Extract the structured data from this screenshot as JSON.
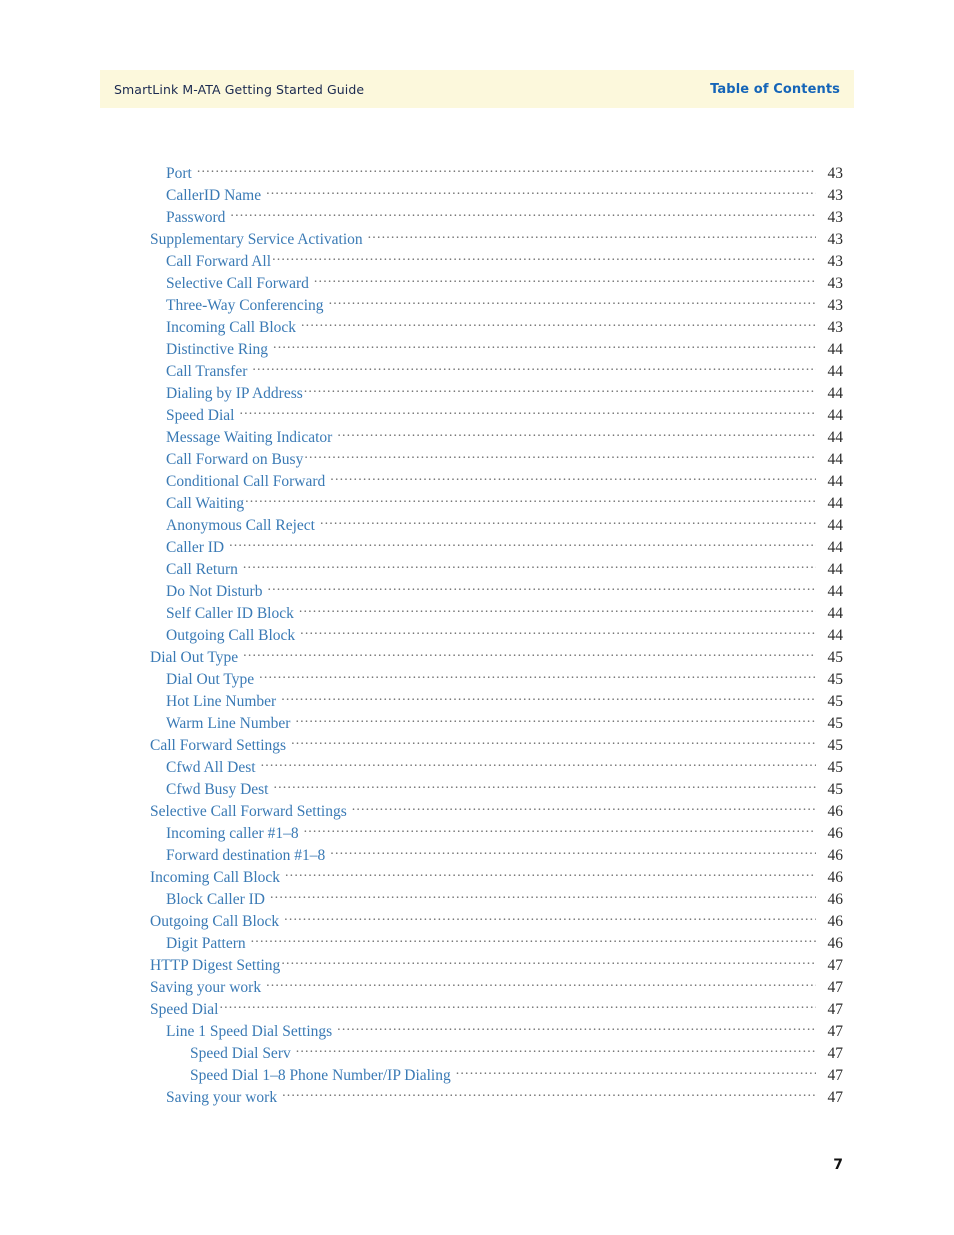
{
  "header": {
    "document_title": "SmartLink M-ATA Getting Started Guide",
    "section_title": "Table of Contents",
    "background_color": "#fcf8dc",
    "title_color": "#1b2a50",
    "section_color": "#1565b8"
  },
  "folio": {
    "page_number": "7"
  },
  "toc": {
    "text_color": "#3a7ab5",
    "page_number_color": "#2b2b2b",
    "entries": [
      {
        "label": "Port",
        "page": "43",
        "level": 1,
        "tight": false
      },
      {
        "label": "CallerID Name",
        "page": "43",
        "level": 1,
        "tight": false
      },
      {
        "label": "Password",
        "page": "43",
        "level": 1,
        "tight": false
      },
      {
        "label": "Supplementary Service Activation",
        "page": "43",
        "level": 0,
        "tight": false
      },
      {
        "label": "Call Forward All",
        "page": "43",
        "level": 1,
        "tight": true
      },
      {
        "label": "Selective Call Forward",
        "page": "43",
        "level": 1,
        "tight": false
      },
      {
        "label": "Three-Way Conferencing",
        "page": "43",
        "level": 1,
        "tight": false
      },
      {
        "label": "Incoming Call Block",
        "page": "43",
        "level": 1,
        "tight": false
      },
      {
        "label": "Distinctive Ring",
        "page": "44",
        "level": 1,
        "tight": false
      },
      {
        "label": "Call Transfer",
        "page": "44",
        "level": 1,
        "tight": false
      },
      {
        "label": "Dialing by IP Address",
        "page": "44",
        "level": 1,
        "tight": true
      },
      {
        "label": "Speed Dial",
        "page": "44",
        "level": 1,
        "tight": false
      },
      {
        "label": "Message Waiting Indicator",
        "page": "44",
        "level": 1,
        "tight": false
      },
      {
        "label": "Call Forward on Busy",
        "page": "44",
        "level": 1,
        "tight": true
      },
      {
        "label": "Conditional Call Forward",
        "page": "44",
        "level": 1,
        "tight": false
      },
      {
        "label": "Call Waiting",
        "page": "44",
        "level": 1,
        "tight": true
      },
      {
        "label": "Anonymous Call Reject",
        "page": "44",
        "level": 1,
        "tight": false
      },
      {
        "label": "Caller ID",
        "page": "44",
        "level": 1,
        "tight": false
      },
      {
        "label": "Call Return",
        "page": "44",
        "level": 1,
        "tight": false
      },
      {
        "label": "Do Not Disturb",
        "page": "44",
        "level": 1,
        "tight": false
      },
      {
        "label": "Self Caller ID Block",
        "page": "44",
        "level": 1,
        "tight": false
      },
      {
        "label": "Outgoing Call Block",
        "page": "44",
        "level": 1,
        "tight": false
      },
      {
        "label": "Dial Out Type",
        "page": "45",
        "level": 0,
        "tight": false
      },
      {
        "label": "Dial Out Type",
        "page": "45",
        "level": 1,
        "tight": false
      },
      {
        "label": "Hot Line Number",
        "page": "45",
        "level": 1,
        "tight": false
      },
      {
        "label": "Warm Line Number",
        "page": "45",
        "level": 1,
        "tight": false
      },
      {
        "label": "Call Forward Settings",
        "page": "45",
        "level": 0,
        "tight": false
      },
      {
        "label": "Cfwd All Dest",
        "page": "45",
        "level": 1,
        "tight": false
      },
      {
        "label": "Cfwd Busy Dest",
        "page": "45",
        "level": 1,
        "tight": false
      },
      {
        "label": "Selective Call Forward Settings",
        "page": "46",
        "level": 0,
        "tight": false
      },
      {
        "label": "Incoming caller #1–8",
        "page": "46",
        "level": 1,
        "tight": false
      },
      {
        "label": "Forward destination #1–8",
        "page": "46",
        "level": 1,
        "tight": false
      },
      {
        "label": "Incoming Call Block",
        "page": "46",
        "level": 0,
        "tight": false
      },
      {
        "label": "Block Caller ID",
        "page": "46",
        "level": 1,
        "tight": false
      },
      {
        "label": "Outgoing Call Block",
        "page": "46",
        "level": 0,
        "tight": false
      },
      {
        "label": "Digit Pattern",
        "page": "46",
        "level": 1,
        "tight": false
      },
      {
        "label": "HTTP Digest Setting",
        "page": "47",
        "level": 0,
        "tight": true
      },
      {
        "label": "Saving your work",
        "page": "47",
        "level": 0,
        "tight": false
      },
      {
        "label": "Speed Dial",
        "page": "47",
        "level": 0,
        "tight": true
      },
      {
        "label": "Line 1 Speed Dial Settings",
        "page": "47",
        "level": 1,
        "tight": false
      },
      {
        "label": "Speed Dial Serv",
        "page": "47",
        "level": 2,
        "tight": false
      },
      {
        "label": "Speed Dial 1–8 Phone Number/IP Dialing",
        "page": "47",
        "level": 2,
        "tight": false
      },
      {
        "label": "Saving your work",
        "page": "47",
        "level": 1,
        "tight": false
      }
    ]
  }
}
